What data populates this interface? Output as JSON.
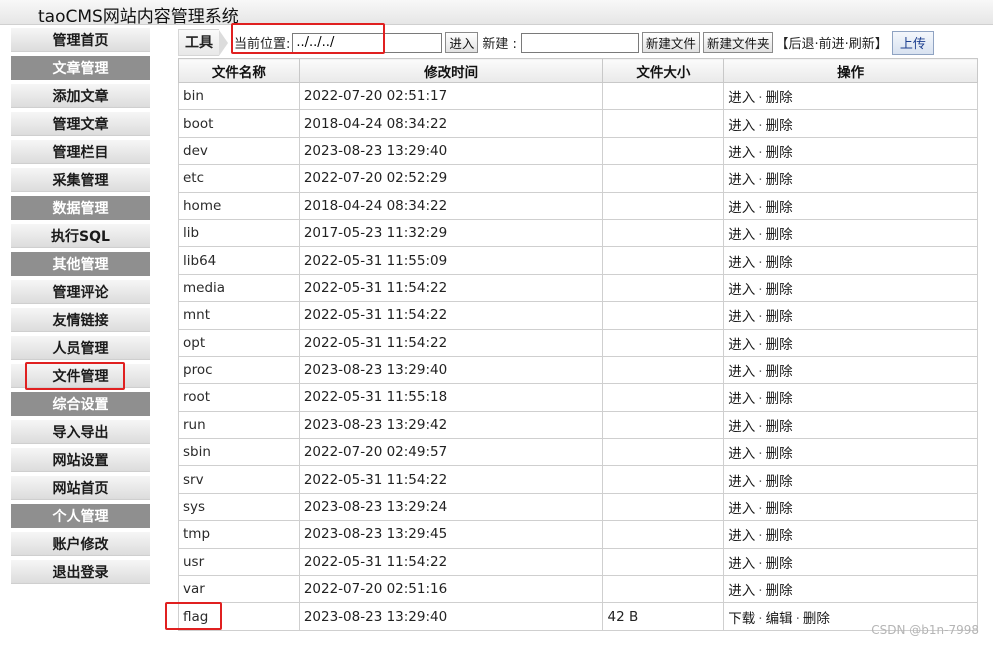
{
  "app": {
    "title": "taoCMS网站内容管理系统"
  },
  "sidebar": {
    "items": [
      {
        "label": "管理首页",
        "kind": "link"
      },
      {
        "label": "文章管理",
        "kind": "section"
      },
      {
        "label": "添加文章",
        "kind": "link"
      },
      {
        "label": "管理文章",
        "kind": "link"
      },
      {
        "label": "管理栏目",
        "kind": "link"
      },
      {
        "label": "采集管理",
        "kind": "link"
      },
      {
        "label": "数据管理",
        "kind": "section"
      },
      {
        "label": "执行SQL",
        "kind": "link"
      },
      {
        "label": "其他管理",
        "kind": "section"
      },
      {
        "label": "管理评论",
        "kind": "link"
      },
      {
        "label": "友情链接",
        "kind": "link"
      },
      {
        "label": "人员管理",
        "kind": "link"
      },
      {
        "label": "文件管理",
        "kind": "link"
      },
      {
        "label": "综合设置",
        "kind": "section"
      },
      {
        "label": "导入导出",
        "kind": "link"
      },
      {
        "label": "网站设置",
        "kind": "link"
      },
      {
        "label": "网站首页",
        "kind": "link"
      },
      {
        "label": "个人管理",
        "kind": "section"
      },
      {
        "label": "账户修改",
        "kind": "link"
      },
      {
        "label": "退出登录",
        "kind": "link"
      }
    ]
  },
  "toolbar": {
    "label": "工具",
    "location_label": "当前位置:",
    "location_value": "../../../",
    "enter_button": "进入",
    "new_label": "新建 :",
    "new_value": "",
    "new_file_button": "新建文件",
    "new_folder_button": "新建文件夹",
    "nav_open": "【",
    "back": "后退",
    "dot1": "·",
    "forward": "前进",
    "dot2": "·",
    "refresh": "刷新",
    "nav_close": "】",
    "upload_button": "上传"
  },
  "table": {
    "headers": [
      "文件名称",
      "修改时间",
      "文件大小",
      "操作"
    ],
    "rows": [
      {
        "name": "bin",
        "time": "2022-07-20 02:51:17",
        "size": "",
        "ops": [
          "进入",
          "删除"
        ]
      },
      {
        "name": "boot",
        "time": "2018-04-24 08:34:22",
        "size": "",
        "ops": [
          "进入",
          "删除"
        ]
      },
      {
        "name": "dev",
        "time": "2023-08-23 13:29:40",
        "size": "",
        "ops": [
          "进入",
          "删除"
        ]
      },
      {
        "name": "etc",
        "time": "2022-07-20 02:52:29",
        "size": "",
        "ops": [
          "进入",
          "删除"
        ]
      },
      {
        "name": "home",
        "time": "2018-04-24 08:34:22",
        "size": "",
        "ops": [
          "进入",
          "删除"
        ]
      },
      {
        "name": "lib",
        "time": "2017-05-23 11:32:29",
        "size": "",
        "ops": [
          "进入",
          "删除"
        ]
      },
      {
        "name": "lib64",
        "time": "2022-05-31 11:55:09",
        "size": "",
        "ops": [
          "进入",
          "删除"
        ]
      },
      {
        "name": "media",
        "time": "2022-05-31 11:54:22",
        "size": "",
        "ops": [
          "进入",
          "删除"
        ]
      },
      {
        "name": "mnt",
        "time": "2022-05-31 11:54:22",
        "size": "",
        "ops": [
          "进入",
          "删除"
        ]
      },
      {
        "name": "opt",
        "time": "2022-05-31 11:54:22",
        "size": "",
        "ops": [
          "进入",
          "删除"
        ]
      },
      {
        "name": "proc",
        "time": "2023-08-23 13:29:40",
        "size": "",
        "ops": [
          "进入",
          "删除"
        ]
      },
      {
        "name": "root",
        "time": "2022-05-31 11:55:18",
        "size": "",
        "ops": [
          "进入",
          "删除"
        ]
      },
      {
        "name": "run",
        "time": "2023-08-23 13:29:42",
        "size": "",
        "ops": [
          "进入",
          "删除"
        ]
      },
      {
        "name": "sbin",
        "time": "2022-07-20 02:49:57",
        "size": "",
        "ops": [
          "进入",
          "删除"
        ]
      },
      {
        "name": "srv",
        "time": "2022-05-31 11:54:22",
        "size": "",
        "ops": [
          "进入",
          "删除"
        ]
      },
      {
        "name": "sys",
        "time": "2023-08-23 13:29:24",
        "size": "",
        "ops": [
          "进入",
          "删除"
        ]
      },
      {
        "name": "tmp",
        "time": "2023-08-23 13:29:45",
        "size": "",
        "ops": [
          "进入",
          "删除"
        ]
      },
      {
        "name": "usr",
        "time": "2022-05-31 11:54:22",
        "size": "",
        "ops": [
          "进入",
          "删除"
        ]
      },
      {
        "name": "var",
        "time": "2022-07-20 02:51:16",
        "size": "",
        "ops": [
          "进入",
          "删除"
        ]
      },
      {
        "name": "flag",
        "time": "2023-08-23 13:29:40",
        "size": "42 B",
        "ops": [
          "下载",
          "编辑",
          "删除"
        ]
      }
    ]
  },
  "ops_separator": "·",
  "watermark": "CSDN @b1n-7998",
  "colors": {
    "highlight": "#e02020",
    "section_bg": "#8f8f8f",
    "upload_text": "#1d3f8f"
  }
}
